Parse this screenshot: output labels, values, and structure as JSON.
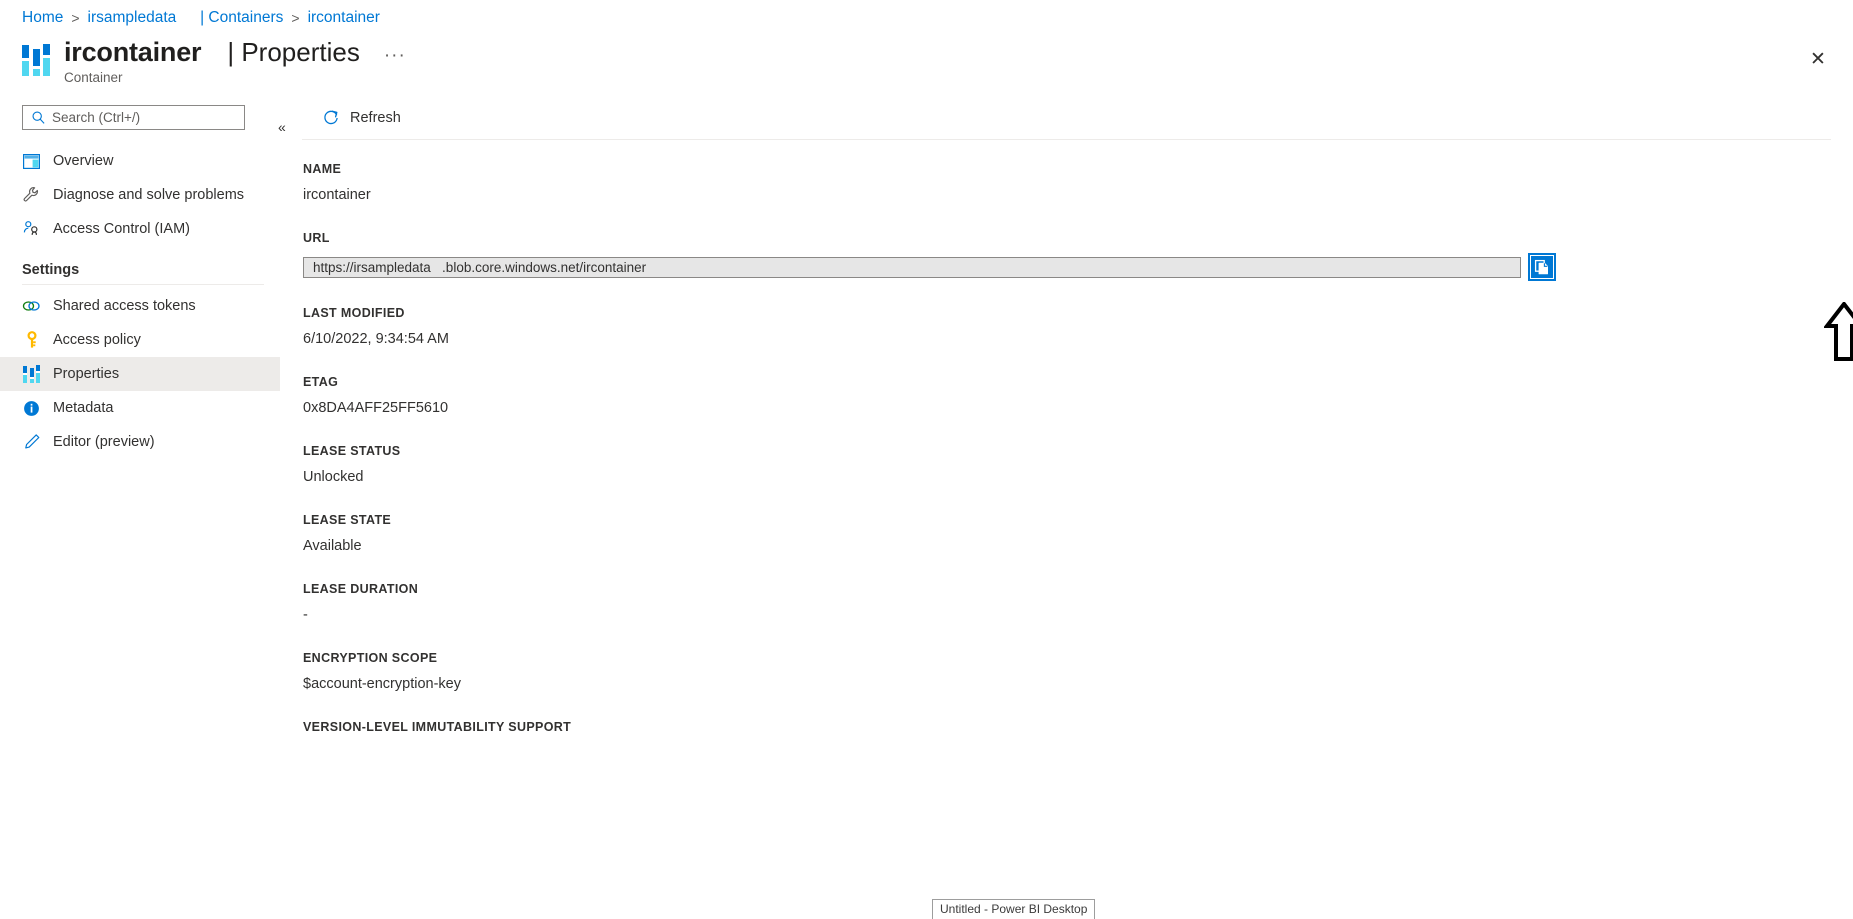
{
  "breadcrumb": {
    "items": [
      {
        "label": "Home",
        "type": "link"
      },
      {
        "label": "irsampledata",
        "type": "link"
      },
      {
        "label": "| Containers",
        "type": "link"
      },
      {
        "label": "ircontainer",
        "type": "link"
      }
    ],
    "separator": ">"
  },
  "header": {
    "icon": "container-icon",
    "title": "ircontainer",
    "section": "| Properties",
    "subtitle": "Container",
    "more_label": "···",
    "close_label": "✕"
  },
  "sidebar": {
    "search": {
      "placeholder": "Search (Ctrl+/)",
      "value": "",
      "icon": "search-icon"
    },
    "collapse_label": "«",
    "items": [
      {
        "label": "Overview",
        "icon": "overview-icon",
        "selected": false
      },
      {
        "label": "Diagnose and solve problems",
        "icon": "wrench-icon",
        "selected": false
      },
      {
        "label": "Access Control (IAM)",
        "icon": "person-key-icon",
        "selected": false
      }
    ],
    "group": {
      "title": "Settings",
      "items": [
        {
          "label": "Shared access tokens",
          "icon": "link-chain-icon",
          "selected": false
        },
        {
          "label": "Access policy",
          "icon": "key-icon",
          "selected": false
        },
        {
          "label": "Properties",
          "icon": "container-icon",
          "selected": true
        },
        {
          "label": "Metadata",
          "icon": "info-icon",
          "selected": false
        },
        {
          "label": "Editor (preview)",
          "icon": "pencil-icon",
          "selected": false
        }
      ]
    }
  },
  "toolbar": {
    "refresh_label": "Refresh",
    "refresh_icon": "refresh-icon"
  },
  "properties": [
    {
      "label": "NAME",
      "value": "ircontainer",
      "kind": "text"
    },
    {
      "label": "URL",
      "value": "https://irsampledata   .blob.core.windows.net/ircontainer",
      "kind": "input"
    },
    {
      "label": "LAST MODIFIED",
      "value": "6/10/2022, 9:34:54 AM",
      "kind": "text"
    },
    {
      "label": "ETAG",
      "value": "0x8DA4AFF25FF5610",
      "kind": "text"
    },
    {
      "label": "LEASE STATUS",
      "value": "Unlocked",
      "kind": "text"
    },
    {
      "label": "LEASE STATE",
      "value": "Available",
      "kind": "text"
    },
    {
      "label": "LEASE DURATION",
      "value": "-",
      "kind": "text"
    },
    {
      "label": "ENCRYPTION SCOPE",
      "value": "$account-encryption-key",
      "kind": "text"
    },
    {
      "label": "VERSION-LEVEL IMMUTABILITY SUPPORT",
      "value": "",
      "kind": "text"
    }
  ],
  "copy_button": {
    "name": "copy-to-clipboard-button",
    "icon": "copy-icon"
  },
  "annotation": {
    "arrow": "up-arrow-pointing-to-copy-button"
  },
  "taskbar": {
    "tooltip": "Untitled - Power BI Desktop"
  },
  "colors": {
    "accent": "#0078d4",
    "link": "#0078d4",
    "text": "#323130",
    "muted": "#605e5c",
    "selected_bg": "#edebe9",
    "input_bg": "#e6e6e6",
    "icon_cyan": "#50d7f0"
  }
}
